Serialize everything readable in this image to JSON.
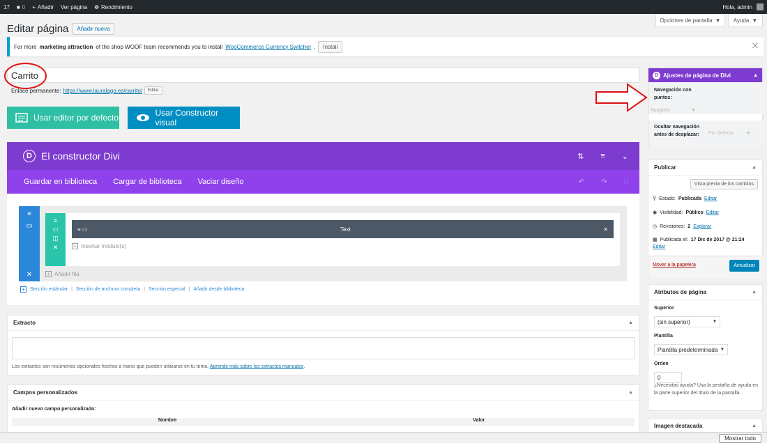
{
  "adminbar": {
    "count": "17",
    "comments": "0",
    "add": "Añadir",
    "view": "Ver página",
    "performance": "Rendimiento",
    "greeting": "Hola, admin"
  },
  "screen_options": "Opciones de pantalla",
  "help": "Ayuda",
  "heading": {
    "title": "Editar página",
    "add_new": "Añadir nueva"
  },
  "notice": {
    "text1": "For more",
    "bold": "marketing attraction",
    "text2": "of the shop WOOF team recommends you to install",
    "link": "WooCommerce Currency Switcher",
    "dot": ".",
    "install": "Install"
  },
  "page_title": "Carrito",
  "permalink": {
    "label": "Enlace permanente:",
    "url": "https://www.lauralago.es/carrito/",
    "edit": "Editar"
  },
  "buttons": {
    "default_editor": "Usar editor por defecto",
    "visual_builder": "Usar Constructor visual"
  },
  "divi": {
    "logo": "D",
    "title": "El constructor Divi",
    "bar": [
      "Guardar en biblioteca",
      "Cargar de biblioteca",
      "Vaciar diseño"
    ],
    "module": "Text",
    "insert_module": "Insertar módulo(s)",
    "add_row": "Añadir fila",
    "section_links": [
      "Sección estándar",
      "Sección de anchura completa",
      "Sección especial",
      "Añadir desde biblioteca"
    ]
  },
  "excerpt": {
    "title": "Extracto",
    "help": "Los extractos son resúmenes opcionales hechos a mano que pueden utilizarse en tu tema.",
    "link": "Aprende más sobre los extractos manuales",
    "dot": "."
  },
  "custom_fields": {
    "title": "Campos personalizados",
    "add_new": "Añadir nuevo campo personalizado:",
    "col_name": "Nombre",
    "col_value": "Valor"
  },
  "divi_settings": {
    "title": "Ajustes de página de Divi",
    "dot_nav": "Navegación con puntos:",
    "dot_nav_value": "Apagado",
    "hide_nav": "Ocultar navegación antes de desplazar:",
    "hide_nav_value": "Por defecto"
  },
  "publish": {
    "title": "Publicar",
    "preview": "Vista previa de los cambios",
    "status_label": "Estado:",
    "status": "Publicada",
    "visibility_label": "Visibilidad:",
    "visibility": "Público",
    "revisions_label": "Revisiones:",
    "revisions": "2",
    "explore": "Explorar",
    "published_label": "Publicada el:",
    "published": "17 Dic de 2017 @ 21:24",
    "edit": "Editar",
    "trash": "Mover a la papelera",
    "update": "Actualizar"
  },
  "attributes": {
    "title": "Atributos de página",
    "parent_label": "Superior",
    "parent": "(sin superior)",
    "template_label": "Plantilla",
    "template": "Plantilla predeterminada",
    "order_label": "Orden",
    "order": "0",
    "help": "¿Necesitas ayuda? Usa la pestaña de ayuda en la parte superior del título de la pantalla."
  },
  "featured_image": {
    "title": "Imagen destacada"
  },
  "taskbar": {
    "show_all": "Mostrar todo"
  }
}
